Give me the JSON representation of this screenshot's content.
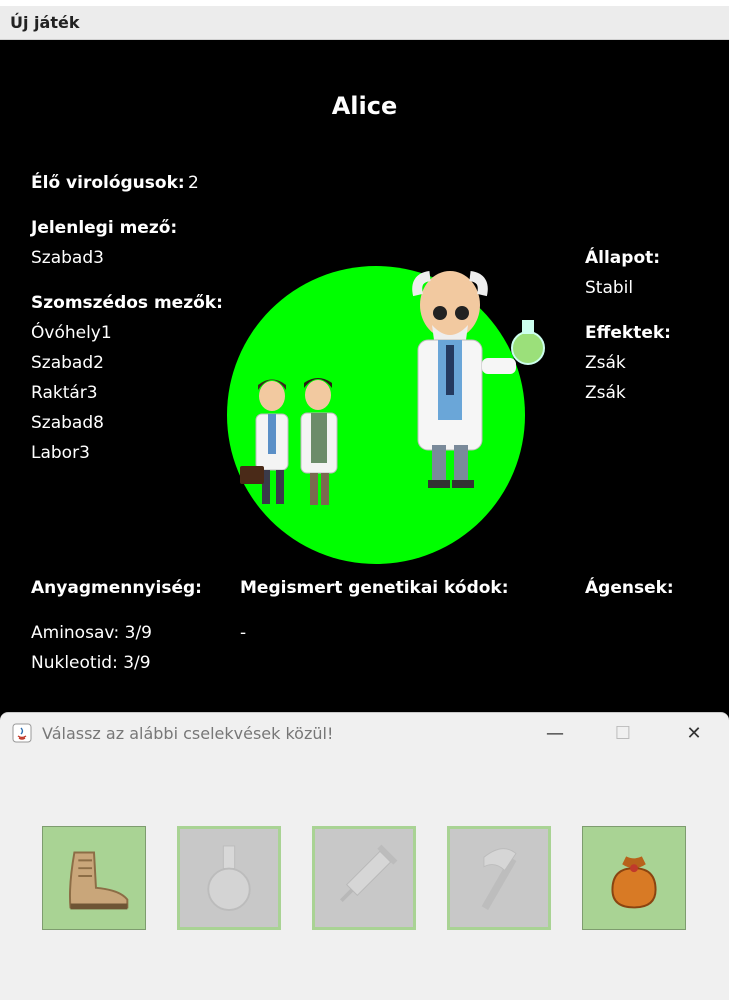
{
  "window": {
    "title": "Új játék"
  },
  "game": {
    "player_name": "Alice",
    "alive_label": "Élő virológusok:",
    "alive_count": "2",
    "current_field_label": "Jelenlegi mező:",
    "current_field": "Szabad3",
    "neighbors_label": "Szomszédos mezők:",
    "neighbors": [
      "Óvóhely1",
      "Szabad2",
      "Raktár3",
      "Szabad8",
      "Labor3"
    ],
    "state_label": "Állapot:",
    "state": "Stabil",
    "effects_label": "Effektek:",
    "effects": [
      "Zsák",
      "Zsák"
    ],
    "materials_label": "Anyagmennyiség:",
    "materials": [
      "Aminosav: 3/9",
      "Nukleotid: 3/9"
    ],
    "codes_label": "Megismert genetikai kódok:",
    "codes": [
      "-"
    ],
    "agents_label": "Ágensek:",
    "colors": {
      "circle": "#00ff00",
      "background": "#000000"
    }
  },
  "dialog": {
    "title": "Válassz az alábbi cselekvések közül!",
    "minimize_glyph": "—",
    "maximize_glyph": "☐",
    "close_glyph": "✕",
    "actions": [
      {
        "icon": "boot-icon",
        "enabled": true
      },
      {
        "icon": "flask-icon",
        "enabled": false
      },
      {
        "icon": "syringe-icon",
        "enabled": false
      },
      {
        "icon": "axe-icon",
        "enabled": false
      },
      {
        "icon": "sack-icon",
        "enabled": true
      }
    ],
    "colors": {
      "enabled": "#a9d394",
      "disabled": "#c8c8c8"
    }
  }
}
